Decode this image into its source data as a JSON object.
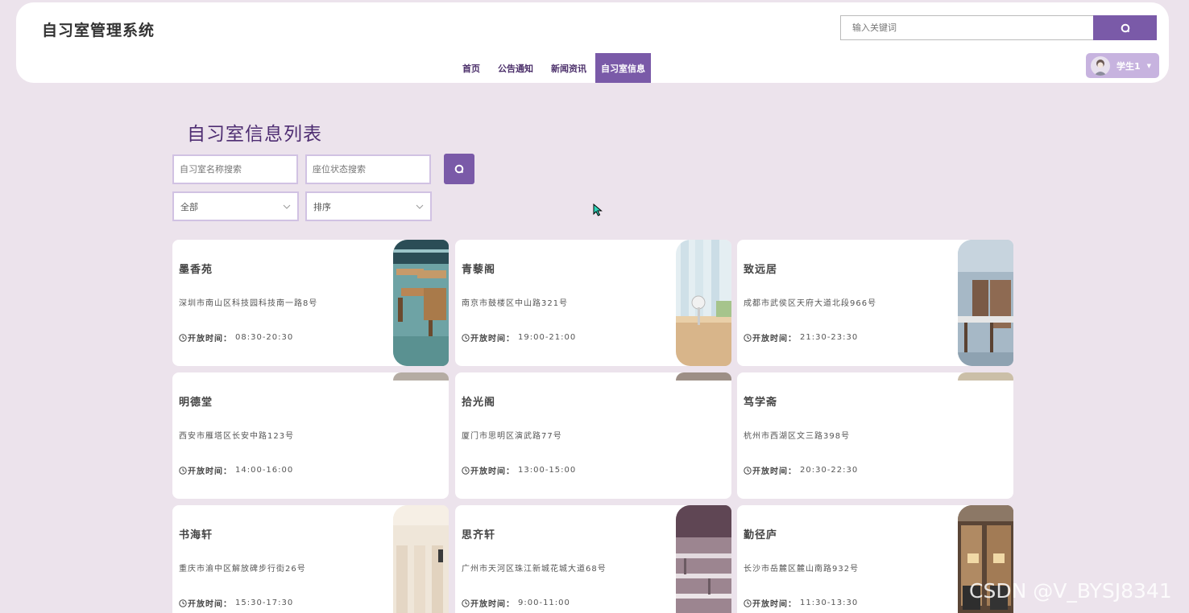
{
  "brand": "自习室管理系统",
  "search": {
    "placeholder": "输入关键词"
  },
  "nav": [
    {
      "label": "首页"
    },
    {
      "label": "公告通知"
    },
    {
      "label": "新闻资讯"
    },
    {
      "label": "自习室信息",
      "active": true
    }
  ],
  "user": {
    "name": "学生1"
  },
  "page": {
    "title": "自习室信息列表"
  },
  "filters": {
    "name_placeholder": "自习室名称搜索",
    "seat_placeholder": "座位状态搜索",
    "category_selected": "全部",
    "sort_selected": "排序"
  },
  "time_label": "开放时间：",
  "rooms": [
    {
      "name": "墨香苑",
      "address": "深圳市南山区科技园科技南一路8号",
      "open_time": "08:30-20:30",
      "image": "library-tables"
    },
    {
      "name": "青藜阁",
      "address": "南京市鼓楼区中山路321号",
      "open_time": "19:00-21:00",
      "image": "desk-lamp"
    },
    {
      "name": "致远居",
      "address": "成都市武侯区天府大道北段966号",
      "open_time": "21:30-23:30",
      "image": "study-desks"
    },
    {
      "name": "明德堂",
      "address": "西安市雁塔区长安中路123号",
      "open_time": "14:00-16:00",
      "image": "room"
    },
    {
      "name": "拾光阁",
      "address": "厦门市思明区演武路77号",
      "open_time": "13:00-15:00",
      "image": "room"
    },
    {
      "name": "笃学斋",
      "address": "杭州市西湖区文三路398号",
      "open_time": "20:30-22:30",
      "image": "room"
    },
    {
      "name": "书海轩",
      "address": "重庆市渝中区解放碑步行街26号",
      "open_time": "15:30-17:30",
      "image": "study-booths"
    },
    {
      "name": "思齐轩",
      "address": "广州市天河区珠江新城花城大道68号",
      "open_time": "9:00-11:00",
      "image": "study-hall"
    },
    {
      "name": "勤径庐",
      "address": "长沙市岳麓区麓山南路932号",
      "open_time": "11:30-13:30",
      "image": "study-carrels"
    }
  ],
  "watermark": "CSDN @V_BYSJ8341",
  "colors": {
    "accent": "#7a5aa8",
    "background": "#ece3ec",
    "title": "#4e2d72"
  }
}
